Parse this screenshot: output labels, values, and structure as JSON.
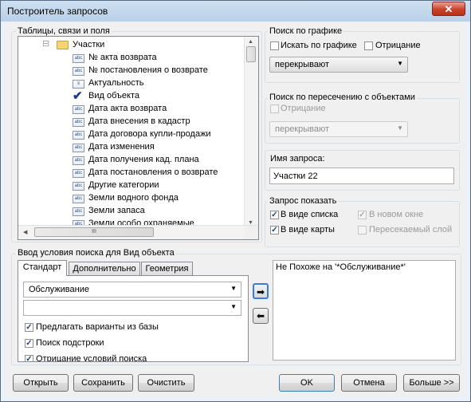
{
  "window": {
    "title": "Построитель запросов",
    "close_glyph": "✕"
  },
  "tree_group": {
    "label": "Таблицы, связи и поля",
    "root": "Участки",
    "items": [
      {
        "label": "№ акта возврата",
        "icon": "abc-field-icon"
      },
      {
        "label": "№ постановления о возврате",
        "icon": "abc-field-icon"
      },
      {
        "label": "Актуальность",
        "icon": "list-field-icon"
      },
      {
        "label": "Вид объекта",
        "icon": "checkmark-icon"
      },
      {
        "label": "Дата акта возврата",
        "icon": "abc-field-icon"
      },
      {
        "label": "Дата внесения в кадастр",
        "icon": "abc-field-icon"
      },
      {
        "label": "Дата договора купли-продажи",
        "icon": "abc-field-icon"
      },
      {
        "label": "Дата изменения",
        "icon": "abc-field-icon"
      },
      {
        "label": "Дата получения кад. плана",
        "icon": "abc-field-icon"
      },
      {
        "label": "Дата постановления о возврате",
        "icon": "abc-field-icon"
      },
      {
        "label": "Другие категории",
        "icon": "abc-field-icon"
      },
      {
        "label": "Земли водного фонда",
        "icon": "abc-field-icon"
      },
      {
        "label": "Земли запаса",
        "icon": "abc-field-icon"
      },
      {
        "label": "Земли особо охраняемые",
        "icon": "abc-field-icon"
      }
    ],
    "scroll_glyphs": {
      "up": "▲",
      "down": "▼",
      "left": "◀",
      "right": "▶",
      "grip": "III"
    }
  },
  "graphic_search": {
    "label": "Поиск по графике",
    "search_label": "Искать по графике",
    "search_checked": false,
    "negation_label": "Отрицание",
    "negation_checked": false,
    "mode_value": "перекрывают"
  },
  "intersect_search": {
    "label": "Поиск по пересечению с объектами",
    "negation_label": "Отрицание",
    "negation_checked": false,
    "mode_value": "перекрывают"
  },
  "query_name": {
    "label": "Имя запроса:",
    "value": "Участки 22"
  },
  "show": {
    "label": "Запрос показать",
    "as_list": "В виде списка",
    "as_list_checked": true,
    "new_window": "В новом окне",
    "new_window_checked": true,
    "as_map": "В виде карты",
    "as_map_checked": true,
    "intersect_layer": "Пересекаемый слой",
    "intersect_layer_checked": false
  },
  "condition": {
    "label": "Ввод условия поиска для Вид объекта",
    "tabs": [
      "Стандарт",
      "Дополнительно",
      "Геометрия"
    ],
    "active_tab": "Стандарт",
    "value_combo": "Обслуживание",
    "second_combo": "",
    "options": [
      {
        "label": "Предлагать варианты из базы",
        "checked": true
      },
      {
        "label": "Поиск подстроки",
        "checked": true
      },
      {
        "label": "Отрицание условий поиска",
        "checked": true
      }
    ],
    "add_glyph": "➡",
    "remove_glyph": "⬅",
    "result_text": "Не Похоже на '*Обслуживание*'"
  },
  "buttons": {
    "open": "Открыть",
    "save": "Сохранить",
    "clear": "Очистить",
    "ok": "OK",
    "cancel": "Отмена",
    "more": "Больше >>"
  },
  "check_glyph": "✓",
  "dropdown_glyph": "▼"
}
